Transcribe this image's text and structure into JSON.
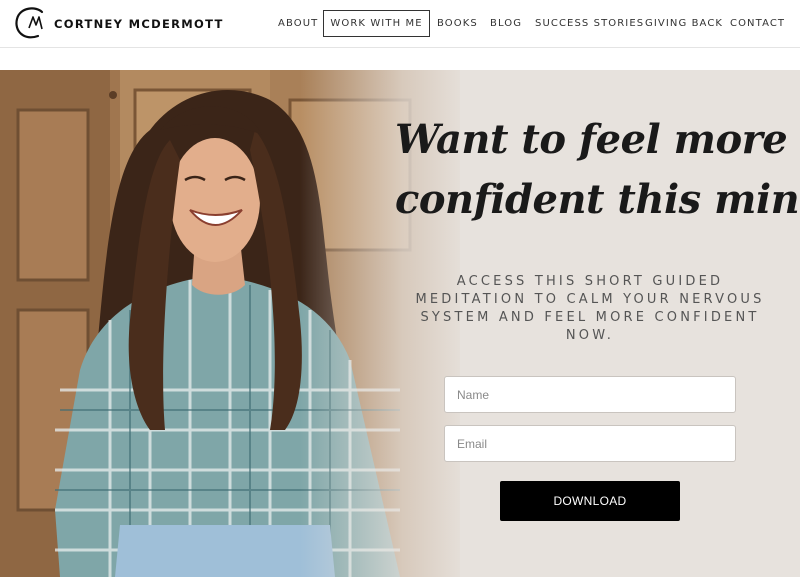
{
  "brand": {
    "name": "CORTNEY MCDERMOTT",
    "logo_icon": "cm-monogram-logo"
  },
  "nav": {
    "items": [
      {
        "label": "ABOUT",
        "active": false
      },
      {
        "label": "WORK WITH ME",
        "active": true
      },
      {
        "label": "BOOKS",
        "active": false
      },
      {
        "label": "BLOG",
        "active": false
      },
      {
        "label": "SUCCESS STORIES",
        "active": false
      },
      {
        "label": "GIVING BACK",
        "active": false
      },
      {
        "label": "CONTACT",
        "active": false
      }
    ]
  },
  "hero": {
    "headline_line1": "Want to feel more",
    "headline_line2": "confident this minute?",
    "subtext": "ACCESS THIS SHORT GUIDED MEDITATION TO CALM YOUR NERVOUS SYSTEM AND FEEL MORE CONFIDENT NOW.",
    "form": {
      "name_placeholder": "Name",
      "name_value": "",
      "email_placeholder": "Email",
      "email_value": "",
      "button_label": "DOWNLOAD"
    }
  },
  "colors": {
    "hero_background": "#e7e2dd",
    "button_background": "#000000",
    "button_text": "#ffffff",
    "text_dark": "#1a1a1a",
    "wood_door": "#a47a52"
  }
}
